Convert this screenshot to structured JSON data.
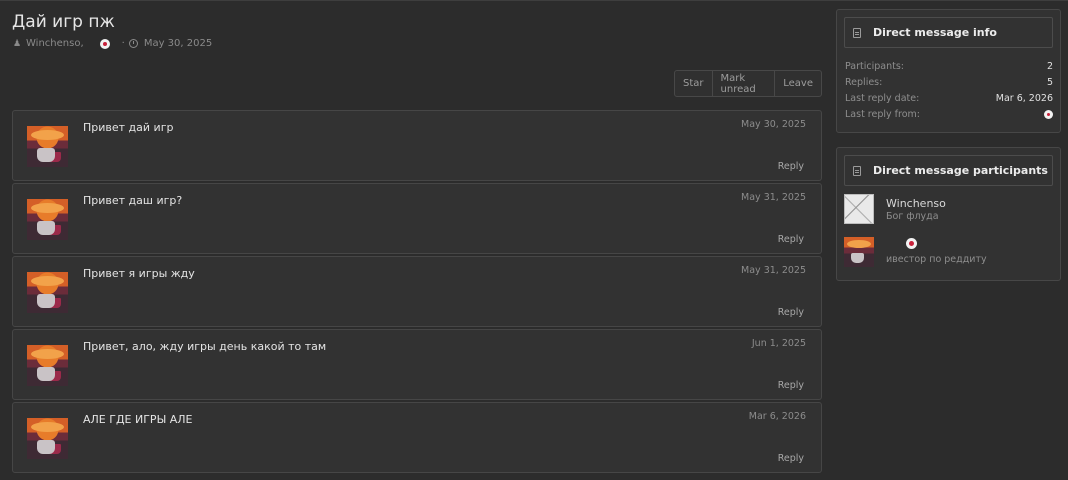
{
  "thread": {
    "title": "Дай игр пж",
    "author": "Winchenso,",
    "date": "May 30, 2025"
  },
  "actions": {
    "star": "Star",
    "mark_unread": "Mark unread",
    "leave": "Leave"
  },
  "messages": [
    {
      "text": "Привет дай игр",
      "date": "May 30, 2025",
      "reply": "Reply"
    },
    {
      "text": "Привет даш игр?",
      "date": "May 31, 2025",
      "reply": "Reply"
    },
    {
      "text": "Привет я игры жду",
      "date": "May 31, 2025",
      "reply": "Reply"
    },
    {
      "text": "Привет, ало, жду игры день какой то там",
      "date": "Jun 1, 2025",
      "reply": "Reply"
    },
    {
      "text": "АЛЕ ГДЕ ИГРЫ АЛЕ",
      "date": "Mar 6, 2026",
      "reply": "Reply"
    }
  ],
  "info": {
    "heading": "Direct message info",
    "participants_label": "Participants:",
    "participants_value": "2",
    "replies_label": "Replies:",
    "replies_value": "5",
    "last_reply_date_label": "Last reply date:",
    "last_reply_date_value": "Mar 6, 2026",
    "last_reply_from_label": "Last reply from:"
  },
  "participants": {
    "heading": "Direct message participants",
    "list": [
      {
        "name": "Winchenso",
        "title": "Бог флуда"
      },
      {
        "name": "",
        "title": "ивестор по реддиту"
      }
    ]
  },
  "icons": {
    "author": "users-icon",
    "date": "clock-icon",
    "block": "document-icon"
  }
}
